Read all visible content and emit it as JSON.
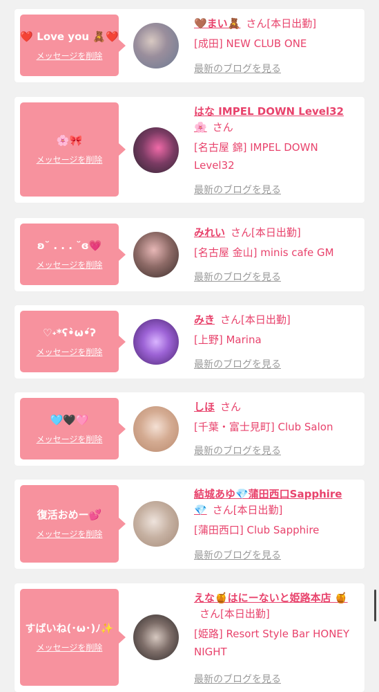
{
  "cards": [
    {
      "message": "❤️ Love you 🧸❤️",
      "delete_label": "メッセージを削除",
      "name": "🤎まい🧸",
      "honorific": "さん",
      "today": "[本日出勤]",
      "shop": "[成田] NEW CLUB ONE",
      "blog_label": "最新のブログを見る",
      "avatar_colors": [
        "#6b7a93",
        "#d8c9c2"
      ]
    },
    {
      "message": "🌸🎀",
      "delete_label": "メッセージを削除",
      "name": "はな IMPEL DOWN Level32 🌸",
      "honorific": "さん",
      "today": "",
      "shop": "[名古屋 錦] IMPEL DOWN Level32",
      "blog_label": "最新のブログを見る",
      "avatar_colors": [
        "#2b2530",
        "#f06aa8"
      ]
    },
    {
      "message": "ʚ˘ . . . ˘ɞ💗",
      "delete_label": "メッセージを削除",
      "name": "みれい",
      "honorific": "さん",
      "today": "[本日出勤]",
      "shop": "[名古屋 金山] minis cafe GM",
      "blog_label": "最新のブログを見る",
      "avatar_colors": [
        "#3a2c2a",
        "#e7b7b6"
      ]
    },
    {
      "message": "♡˖*ʕ•̀ω•́ʔ",
      "delete_label": "メッセージを削除",
      "name": "みき",
      "honorific": "さん",
      "today": "[本日出勤]",
      "shop": "[上野] Marina",
      "blog_label": "最新のブログを見る",
      "avatar_colors": [
        "#7c3bb5",
        "#d9b4ff"
      ]
    },
    {
      "message": "🩵🖤🩷",
      "delete_label": "メッセージを削除",
      "name": "しほ",
      "honorific": "さん",
      "today": "",
      "shop": "[千葉・富士見町] Club Salon",
      "blog_label": "最新のブログを見る",
      "avatar_colors": [
        "#b98a6e",
        "#f4e0d4"
      ]
    },
    {
      "message": "復活おめー💕",
      "delete_label": "メッセージを削除",
      "name": "結城あゆ💎蒲田西口Sapphire 💎",
      "honorific": "さん",
      "today": "[本日出勤]",
      "shop": "[蒲田西口] Club Sapphire",
      "blog_label": "最新のブログを見る",
      "avatar_colors": [
        "#a48a78",
        "#eee3dc"
      ]
    },
    {
      "message": "すばいね(･ω･)ﾉ✨",
      "delete_label": "メッセージを削除",
      "name": "えな🍯はにーないと姫路本店 🍯",
      "honorific": "さん",
      "today": "[本日出勤]",
      "shop": "[姫路] Resort Style Bar HONEY NIGHT",
      "blog_label": "最新のブログを見る",
      "avatar_colors": [
        "#2f2a2a",
        "#d6c8c0"
      ]
    }
  ]
}
